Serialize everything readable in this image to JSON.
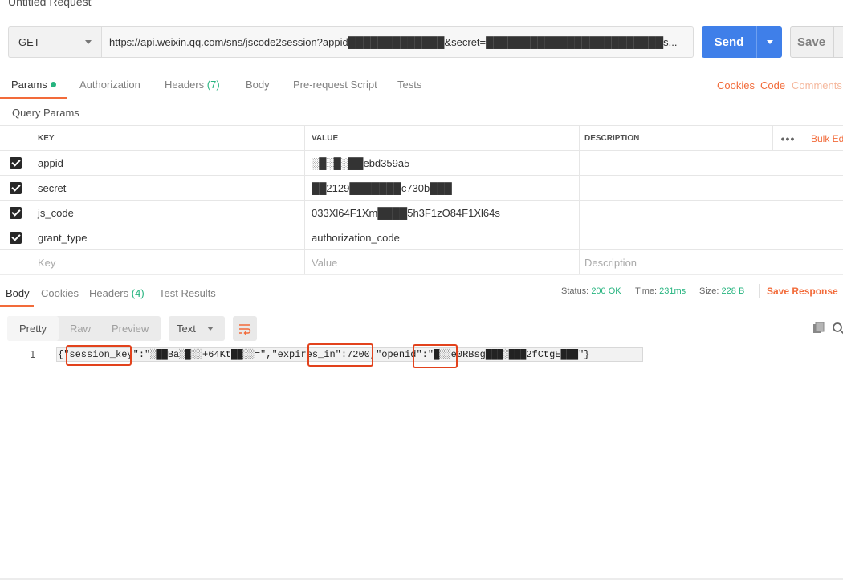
{
  "window": {
    "title": "Untitled Request"
  },
  "request": {
    "method": "GET",
    "url": "https://api.weixin.qq.com/sns/jscode2session?appid█████████████&secret=████████████████████████s...",
    "send_label": "Send",
    "save_label": "Save"
  },
  "request_tabs": {
    "params": "Params",
    "authorization": "Authorization",
    "headers": "Headers",
    "headers_count": "(7)",
    "body": "Body",
    "prerequest": "Pre-request Script",
    "tests": "Tests",
    "cookies": "Cookies",
    "code": "Code",
    "comments": "Comments"
  },
  "query_params": {
    "title": "Query Params",
    "columns": {
      "key": "KEY",
      "value": "VALUE",
      "description": "DESCRIPTION"
    },
    "bulk_edit": "Bulk Edit",
    "rows": [
      {
        "key": "appid",
        "value": "░█░█░██ebd359a5",
        "description": ""
      },
      {
        "key": "secret",
        "value": "██2129███████c730b███",
        "description": ""
      },
      {
        "key": "js_code",
        "value": "033Xl64F1Xm████5h3F1zO84F1Xl64s",
        "description": ""
      },
      {
        "key": "grant_type",
        "value": "authorization_code",
        "description": ""
      }
    ],
    "placeholder": {
      "key": "Key",
      "value": "Value",
      "description": "Description"
    }
  },
  "response_tabs": {
    "body": "Body",
    "cookies": "Cookies",
    "headers": "Headers",
    "headers_count": "(4)",
    "test_results": "Test Results"
  },
  "response_status": {
    "status_label": "Status:",
    "status_value": "200 OK",
    "time_label": "Time:",
    "time_value": "231ms",
    "size_label": "Size:",
    "size_value": "228 B",
    "save_response": "Save Response"
  },
  "response_toolbar": {
    "pretty": "Pretty",
    "raw": "Raw",
    "preview": "Preview",
    "format": "Text"
  },
  "response_body": {
    "line_number": "1",
    "text": "{\"session_key\":\"░██Ba░█░░+64Kt██░░=\",\"expires_in\":7200,\"openid\":\"█░░e0RBsg███░███2fCtgE███\"}"
  }
}
